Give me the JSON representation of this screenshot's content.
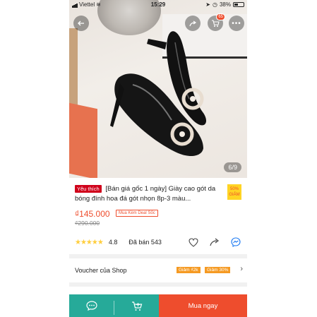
{
  "status_bar": {
    "carrier": "Viettel",
    "time": "15:29",
    "battery": "38%"
  },
  "photo": {
    "counter": "6/9",
    "cart_badge": "65"
  },
  "product": {
    "tag": "Yêu thích",
    "title": "[Bán giá gốc 1 ngày] Giày cao gót da bóng đính hoa đá gót nhọn 8p-3 màu...",
    "discount_badge": "50% GIẢM",
    "price": "₫145.000",
    "deal_tag": "Mua Kèm Deal Sốc",
    "old_price": "₫290.000",
    "rating": "4.8",
    "sold": "Đã bán 543",
    "rating_stars": 4.8
  },
  "voucher": {
    "label": "Voucher của Shop",
    "tags": [
      "Giảm ₫2k",
      "Giảm 30%"
    ]
  },
  "bottom_bar": {
    "buy_label": "Mua ngay"
  },
  "colors": {
    "accent": "#ee4d2d",
    "chat_green": "#26aa99",
    "star": "#ffce3d",
    "badge_yellow": "#ffd424"
  }
}
